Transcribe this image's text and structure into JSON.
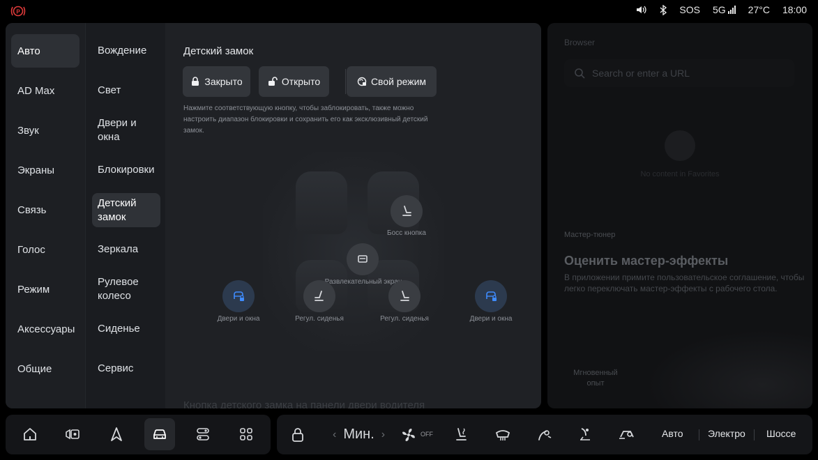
{
  "status": {
    "sos": "SOS",
    "network": "5G",
    "temperature": "27°C",
    "time": "18:00"
  },
  "nav": {
    "items": [
      {
        "label": "Авто",
        "active": true
      },
      {
        "label": "AD Max"
      },
      {
        "label": "Звук"
      },
      {
        "label": "Экраны"
      },
      {
        "label": "Связь"
      },
      {
        "label": "Голос"
      },
      {
        "label": "Режим"
      },
      {
        "label": "Аксессуары"
      },
      {
        "label": "Общие"
      }
    ]
  },
  "subnav": {
    "items": [
      {
        "label": "Вождение"
      },
      {
        "label": "Свет"
      },
      {
        "label": "Двери и окна"
      },
      {
        "label": "Блокировки"
      },
      {
        "label": "Детский замок",
        "active": true
      },
      {
        "label": "Зеркала"
      },
      {
        "label": "Рулевое колесо"
      },
      {
        "label": "Сиденье"
      },
      {
        "label": "Сервис"
      }
    ]
  },
  "child_lock": {
    "title": "Детский замок",
    "buttons": {
      "closed": "Закрыто",
      "open": "Открыто",
      "custom": "Свой режим"
    },
    "hint": "Нажмите соответствующую кнопку, чтобы заблокировать, также можно настроить диапазон блокировки и сохранить его как эксклюзивный детский замок.",
    "controls": {
      "boss_button": "Босс кнопка",
      "entertainment_screen": "Развлекательный экран",
      "doors_windows_left": "Двери и окна",
      "seat_adjust_left": "Регул. сиденья",
      "seat_adjust_right": "Регул. сиденья",
      "doors_windows_right": "Двери и окна"
    },
    "faded_footer": "Кнопка детского замка на панели двери водителя"
  },
  "browser": {
    "label": "Browser",
    "search_placeholder": "Search or enter a URL",
    "no_content": "No content in Favorites",
    "tuner_label": "Мастер-тюнер",
    "tuner_title": "Оценить мастер-эффекты",
    "tuner_desc": "В приложении примите пользовательское соглашение, чтобы легко переключать мастер-эффекты с рабочего стола.",
    "instant": "Мгновенный опыт"
  },
  "dock": {
    "fan_level": "Мин.",
    "fan_state": "OFF",
    "drive_modes": [
      "Авто",
      "Электро",
      "Шоссе"
    ]
  },
  "colors": {
    "accent_blue": "#3f8cff",
    "alert_red": "#e23b3b",
    "panel_bg": "#1c1e22"
  }
}
